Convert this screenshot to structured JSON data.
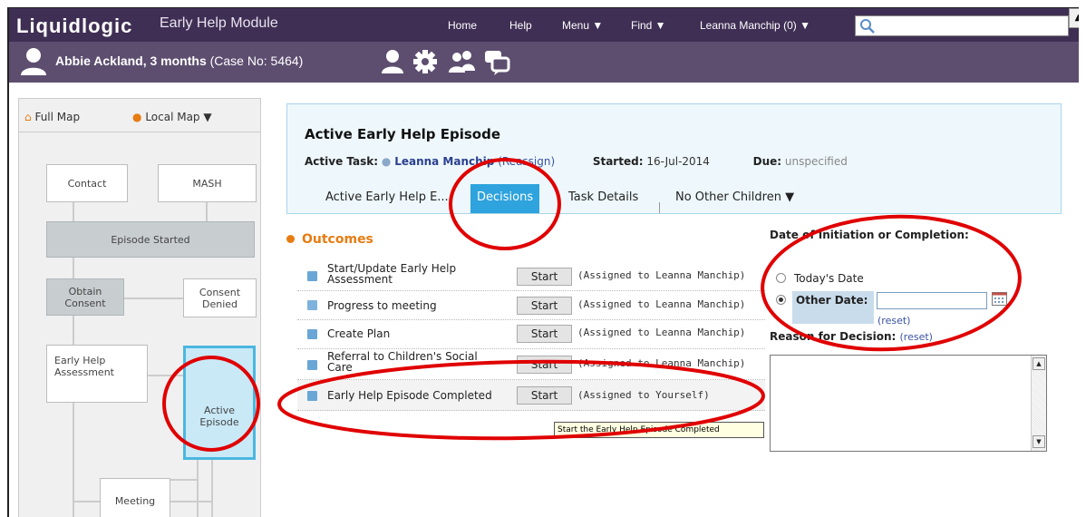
{
  "top": {
    "logo": "Liquidlogic",
    "app_name": "Early Help Module",
    "nav": [
      "Home",
      "Help",
      "Menu ▼",
      "Find ▼",
      "Leanna Manchip (0) ▼"
    ],
    "search_value": ""
  },
  "case": {
    "name": "Abbie Ackland, 3 months",
    "case_no": "(Case No: 5464)",
    "icons": [
      "person-icon",
      "gear-icon",
      "people-icon",
      "chat-icon"
    ]
  },
  "sidebar": {
    "full_map": "Full Map",
    "local_map": "Local Map ▼",
    "nodes": {
      "contact": "Contact",
      "mash": "MASH",
      "episode_started": "Episode Started",
      "obtain_consent": "Obtain Consent",
      "consent_denied": "Consent Denied",
      "assessment": "Early Help Assessment",
      "active_episode": "Active Episode",
      "meeting": "Meeting"
    }
  },
  "episode": {
    "title": "Active Early Help Episode",
    "task_label": "Active Task:",
    "task_user": "Leanna Manchip",
    "reassign": "(Reassign)",
    "started_label": "Started:",
    "started": "16-Jul-2014",
    "due_label": "Due:",
    "due": "unspecified",
    "tabs": [
      "Active Early Help E...",
      "Decisions",
      "Task Details",
      "No Other Children ▼"
    ]
  },
  "outcomes": {
    "heading": "Outcomes",
    "start_label": "Start",
    "rows": [
      {
        "label": "Start/Update Early Help Assessment",
        "assigned": "(Assigned to Leanna Manchip)"
      },
      {
        "label": "Progress to meeting",
        "assigned": "(Assigned to Leanna Manchip)"
      },
      {
        "label": "Create Plan",
        "assigned": "(Assigned to Leanna Manchip)"
      },
      {
        "label": "Referral to Children's Social Care",
        "assigned": "(Assigned to Leanna Manchip)"
      },
      {
        "label": "Early Help Episode Completed",
        "assigned": "(Assigned to Yourself)"
      }
    ],
    "tooltip": "Start the Early Help Episode Completed"
  },
  "decision": {
    "date_heading": "Date of Initiation or Completion:",
    "todays_date": "Today's Date",
    "other_date": "Other Date:",
    "other_date_value": "",
    "reset": "(reset)",
    "reason_heading": "Reason for Decision:",
    "reason_value": ""
  },
  "colors": {
    "topbar": "#3f2f54",
    "casebar": "#5d4e70",
    "tab_selected": "#2ea3dd",
    "outcomes_accent": "#e67c12",
    "annotation": "#e00000"
  }
}
